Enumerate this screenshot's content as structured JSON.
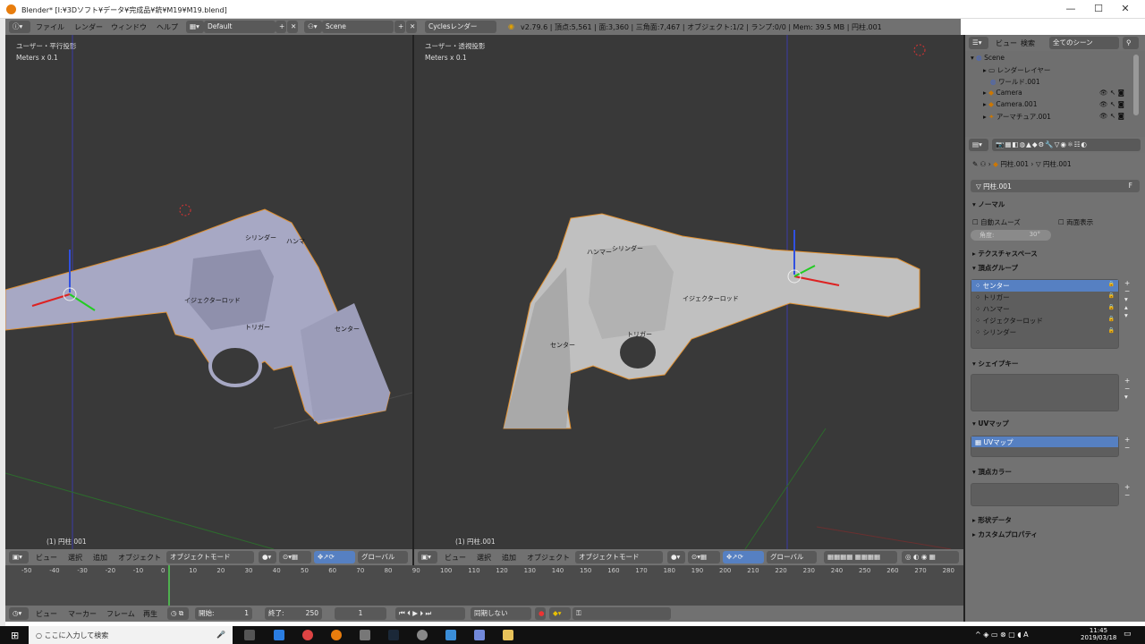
{
  "window": {
    "title": "Blender* [I:¥3Dソフト¥データ¥完成品¥銃¥M19¥M19.blend]",
    "min": "—",
    "max": "☐",
    "close": "✕"
  },
  "top_header": {
    "menus": [
      "ファイル",
      "レンダー",
      "ウィンドウ",
      "ヘルプ"
    ],
    "layout": "Default",
    "scene": "Scene",
    "engine": "Cyclesレンダー",
    "stats": "v2.79.6 | 頂点:5,561 | 面:3,360 | 三角面:7,467 | オブジェクト:1/2 | ランプ:0/0 | Mem: 39.5 MB | 円柱.001"
  },
  "left_view": {
    "name": "ユーザー・平行投影",
    "scale": "Meters x 0.1",
    "object": "(1) 円柱.001",
    "labels": {
      "cyl": "シリンダー",
      "ham": "ハンマ",
      "ej": "イジェクターロッド",
      "tr": "トリガー",
      "ce": "センター"
    }
  },
  "right_view": {
    "name": "ユーザー・透視投影",
    "scale": "Meters x 0.1",
    "object": "(1) 円柱.001",
    "labels": {
      "cyl": "シリンダー",
      "ham": "ハンマー",
      "ej": "イジェクターロッド",
      "tr": "トリガー",
      "ce": "センター"
    }
  },
  "view_header": {
    "view": "ビュー",
    "select": "選択",
    "add": "追加",
    "object": "オブジェクト",
    "mode": "オブジェクトモード",
    "orient": "グローバル"
  },
  "outliner": {
    "view": "ビュー",
    "search": "検索",
    "filter": "全てのシーン",
    "items": [
      "Scene",
      "レンダーレイヤー",
      "ワールド.001",
      "Camera",
      "Camera.001",
      "アーマチュア.001"
    ]
  },
  "properties": {
    "breadcrumb1": "円柱.001",
    "breadcrumb2": "円柱.001",
    "mesh_name": "円柱.001",
    "fake": "F",
    "normal": {
      "title": "ノーマル",
      "autosmooth": "自動スムーズ",
      "double": "両面表示",
      "angle": "角度:",
      "angle_val": "30°"
    },
    "texspace": "テクスチャスペース",
    "vgroups": {
      "title": "頂点グループ",
      "items": [
        "センター",
        "トリガー",
        "ハンマー",
        "イジェクターロッド",
        "シリンダー"
      ]
    },
    "shapekeys": "シェイプキー",
    "uvmaps": {
      "title": "UVマップ",
      "items": [
        "UVマップ"
      ]
    },
    "vcolors": "頂点カラー",
    "geodata": "形状データ",
    "custom": "カスタムプロパティ"
  },
  "timeline": {
    "ticks": [
      "-50",
      "-40",
      "-30",
      "-20",
      "-10",
      "0",
      "10",
      "20",
      "30",
      "40",
      "50",
      "60",
      "70",
      "80",
      "90",
      "100",
      "110",
      "120",
      "130",
      "140",
      "150",
      "160",
      "170",
      "180",
      "190",
      "200",
      "210",
      "220",
      "230",
      "240",
      "250",
      "260",
      "270",
      "280"
    ],
    "view": "ビュー",
    "marker": "マーカー",
    "frame": "フレーム",
    "play": "再生",
    "start_lbl": "開始:",
    "start": "1",
    "end_lbl": "終了:",
    "end": "250",
    "current": "1",
    "sync": "同期しない"
  },
  "taskbar": {
    "search": "ここに入力して検索",
    "time": "11:45",
    "date": "2019/03/18"
  }
}
